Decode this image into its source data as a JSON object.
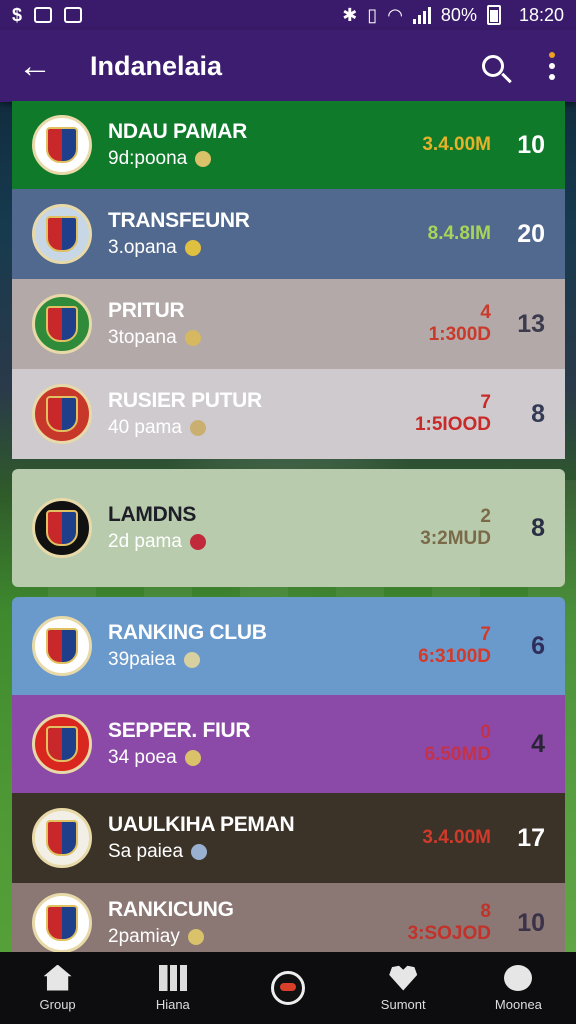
{
  "status_bar": {
    "left_icons": [
      "dollar-icon",
      "image-icon",
      "mail-icon"
    ],
    "battery": "80%",
    "time": "18:20"
  },
  "app_bar": {
    "title": "Indanelaia"
  },
  "rows": [
    {
      "name": "NDAU PAMAR",
      "sub": "9d:poona",
      "money_top": "",
      "money": "3.4.00M",
      "rank": "10",
      "bg": "#0e7a2a",
      "name_color": "#ffffff",
      "sub_color": "#ffffff",
      "money_color": "#e5b22a",
      "rank_color": "#ffffff",
      "avatar_bg": "#ffffff",
      "ball_color": "#d9c26a"
    },
    {
      "name": "TRANSFEUNR",
      "sub": "3.opana",
      "money_top": "",
      "money": "8.4.8IM",
      "rank": "20",
      "bg": "#51698f",
      "name_color": "#ffffff",
      "sub_color": "#ffffff",
      "money_color": "#a8d45a",
      "rank_color": "#ffffff",
      "avatar_bg": "#c8d7e6",
      "ball_color": "#e0c040"
    },
    {
      "name": "PRITUR",
      "sub": "3topana",
      "money_top": "4",
      "money": "1:300D",
      "rank": "13",
      "bg": "#b4a9a9",
      "name_color": "#ffffff",
      "sub_color": "#ffffff",
      "money_color": "#c93a2a",
      "rank_color": "#3b3b4d",
      "avatar_bg": "#2f8a3a",
      "ball_color": "#d5b860"
    },
    {
      "name": "RUSIER PUTUR",
      "sub": "40 pama",
      "money_top": "7",
      "money": "1:5IOOD",
      "rank": "8",
      "bg": "#cfcacd",
      "name_color": "#ffffff",
      "sub_color": "#ffffff",
      "money_color": "#c82a2a",
      "rank_color": "#343a55",
      "avatar_bg": "#c8382a",
      "ball_color": "#c9b070"
    },
    {
      "name": "LAMDNS",
      "sub": "2d pama",
      "money_top": "2",
      "money": "3:2MUD",
      "rank": "8",
      "bg": "#b8ccad",
      "name_color": "#1e1e28",
      "sub_color": "#ffffff",
      "money_color": "#7a6a4a",
      "rank_color": "#2a2e44",
      "avatar_bg": "#111111",
      "ball_color": "#c02a3a"
    },
    {
      "name": "RANKING CLUB",
      "sub": "39paiea",
      "money_top": "7",
      "money": "6:3100D",
      "rank": "6",
      "bg": "#6a9acb",
      "name_color": "#ffffff",
      "sub_color": "#ffffff",
      "money_color": "#d33a2a",
      "rank_color": "#2e2e5a",
      "avatar_bg": "#ffffff",
      "ball_color": "#d8d0a0"
    },
    {
      "name": "SEPPER. FIUR",
      "sub": "34 poea",
      "money_top": "0",
      "money": "6.50MD",
      "rank": "4",
      "bg": "#8c4aa8",
      "name_color": "#ffffff",
      "sub_color": "#ffffff",
      "money_color": "#c2324a",
      "rank_color": "#2a2438",
      "avatar_bg": "#d9261f",
      "ball_color": "#d9c26a"
    },
    {
      "name": "UAULKIHA PEMAN",
      "sub": "Sa paiea",
      "money_top": "",
      "money": "3.4.00M",
      "rank": "17",
      "bg": "#3b3228",
      "name_color": "#ffffff",
      "sub_color": "#ffffff",
      "money_color": "#d03a2a",
      "rank_color": "#ffffff",
      "avatar_bg": "#f2efe6",
      "ball_color": "#9ab0d0"
    },
    {
      "name": "RANKICUNG",
      "sub": "2pamiay",
      "money_top": "8",
      "money": "3:SOJOD",
      "rank": "10",
      "bg": "#8b7774",
      "name_color": "#ffffff",
      "sub_color": "#ffffff",
      "money_color": "#c2322a",
      "rank_color": "#3a3248",
      "avatar_bg": "#ffffff",
      "ball_color": "#d9c26a"
    }
  ],
  "bottom_nav": [
    {
      "label": "Group",
      "icon": "home-icon"
    },
    {
      "label": "Hiana",
      "icon": "chart-icon"
    },
    {
      "label": "",
      "icon": "ball-icon"
    },
    {
      "label": "Sumont",
      "icon": "heart-icon"
    },
    {
      "label": "Moonea",
      "icon": "message-icon"
    }
  ]
}
